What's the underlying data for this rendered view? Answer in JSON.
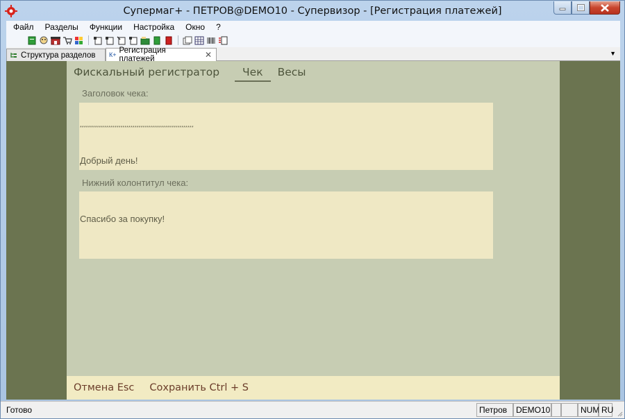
{
  "window": {
    "title": "Супермаг+ - ПЕТРОВ@DEMO10 - Супервизор  - [Регистрация платежей]",
    "accent": "#c8452d"
  },
  "menubar": [
    "Файл",
    "Разделы",
    "Функции",
    "Настройка",
    "Окно",
    "?"
  ],
  "toolbar_icons": [
    "green-doc-icon",
    "group-icon",
    "house-icon",
    "cart-icon",
    "grid-icon",
    "doc1-icon",
    "doc2-icon",
    "doc3-icon",
    "doc4-icon",
    "folder-icon",
    "green-book-icon",
    "red-book-icon",
    "window-icon",
    "table-icon",
    "barcode-icon",
    "list-icon"
  ],
  "doc_tabs": [
    {
      "label": "Структура разделов",
      "icon": "tree-icon"
    },
    {
      "label": "Регистрация платежей",
      "icon_text": "К+"
    }
  ],
  "panel_tabs": {
    "fiscal": "Фискальный регистратор",
    "receipt": "Чек",
    "scales": "Весы"
  },
  "receipt": {
    "header_label": "Заголовок чека:",
    "header_stars": "********************************************************",
    "header_text": "Добрый день!",
    "footer_label": "Нижний колонтитул чека:",
    "footer_text": "Спасибо за покупку!"
  },
  "actions": {
    "cancel": "Отмена Esc",
    "save": "Сохранить Ctrl + S"
  },
  "status": {
    "text": "Готово",
    "user": "Петров",
    "db": "DEMO10",
    "num": "NUM",
    "lang": "RU"
  }
}
